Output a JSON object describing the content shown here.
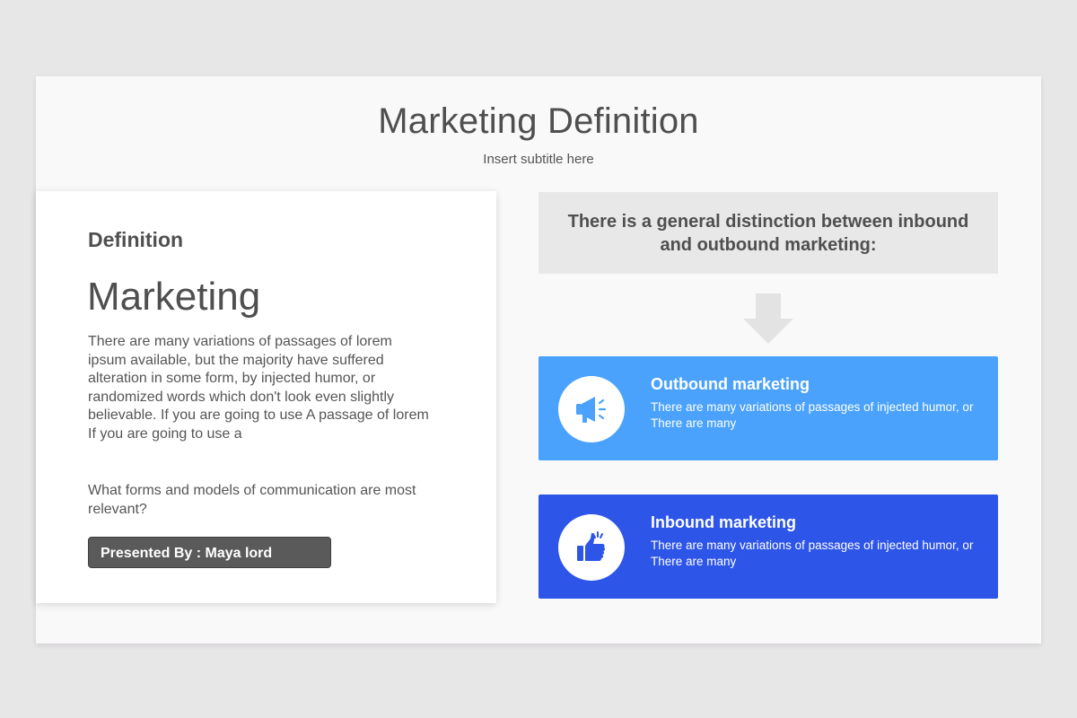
{
  "slide": {
    "title": "Marketing Definition",
    "subtitle": "Insert subtitle here"
  },
  "left_card": {
    "label": "Definition",
    "heading": "Marketing",
    "body": "There are many variations of passages of lorem ipsum available, but the majority have suffered alteration in some form, by injected humor, or randomized words which don't look even slightly believable. If you are going to use A passage of lorem If you are going to use a",
    "question": "What forms and models of communication are most relevant?",
    "presenter": "Presented By : Maya lord"
  },
  "right": {
    "distinction": "There is a general distinction between inbound and outbound marketing:",
    "outbound": {
      "title": "Outbound marketing",
      "text": "There are many variations of passages of injected humor, or There are many",
      "icon": "megaphone-icon"
    },
    "inbound": {
      "title": "Inbound marketing",
      "text": "There are many variations of passages of injected humor, or There are many",
      "icon": "thumbs-up-icon"
    }
  },
  "colors": {
    "outbound": "#4aa2fc",
    "inbound": "#2d55e8",
    "text_dark": "#4f4f4f"
  }
}
